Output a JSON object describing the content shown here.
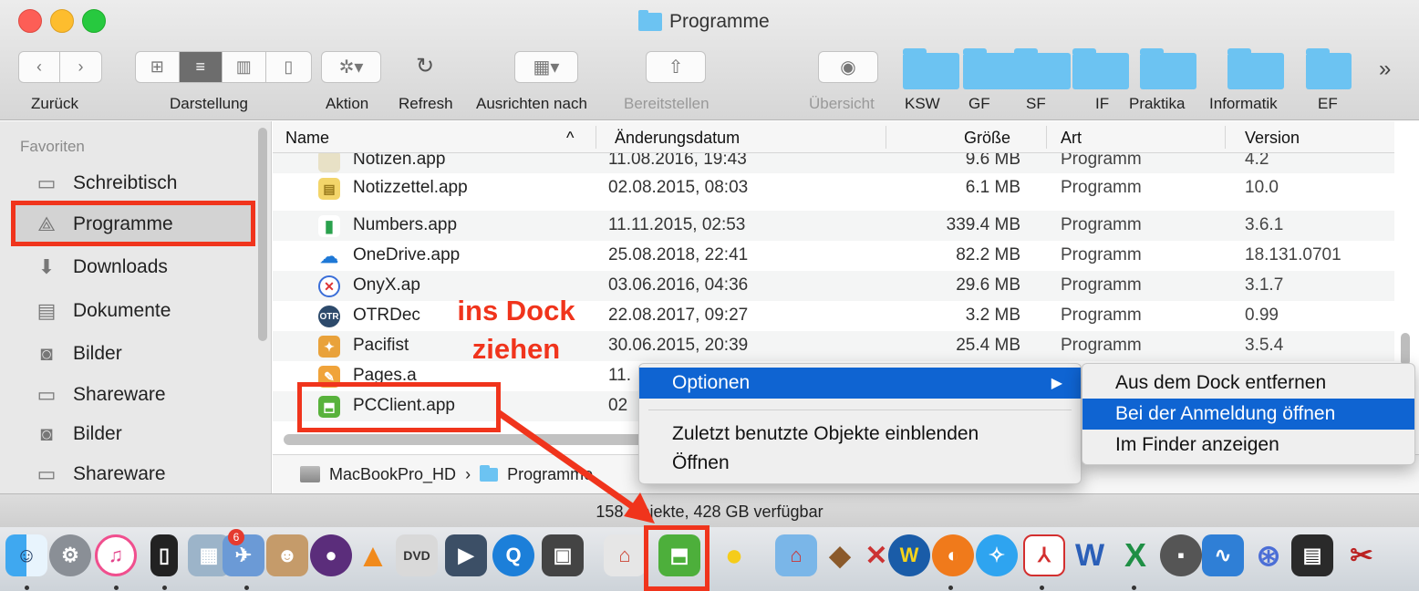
{
  "window": {
    "title": "Programme"
  },
  "toolbar": {
    "back_label": "Zurück",
    "view_label": "Darstellung",
    "action_label": "Aktion",
    "refresh_label": "Refresh",
    "arrange_label": "Ausrichten nach",
    "share_label": "Bereitstellen",
    "quicklook_label": "Übersicht",
    "overflow_glyph": "»",
    "favorites": [
      "KSW",
      "GF",
      "SF",
      "IF",
      "Praktika",
      "Informatik",
      "EF"
    ]
  },
  "sidebar": {
    "heading": "Favoriten",
    "items": [
      {
        "label": "Schreibtisch",
        "icon": "desktop-icon"
      },
      {
        "label": "Programme",
        "icon": "applications-icon"
      },
      {
        "label": "Downloads",
        "icon": "downloads-icon"
      },
      {
        "label": "Dokumente",
        "icon": "documents-icon"
      },
      {
        "label": "Bilder",
        "icon": "camera-icon"
      },
      {
        "label": "Shareware",
        "icon": "folder-icon"
      },
      {
        "label": "Bilder",
        "icon": "camera-icon"
      },
      {
        "label": "Shareware",
        "icon": "folder-icon"
      }
    ]
  },
  "columns": {
    "name": "Name",
    "sort_glyph": "^",
    "date": "Änderungsdatum",
    "size": "Größe",
    "kind": "Art",
    "version": "Version"
  },
  "files": [
    {
      "name": "Notizen.app",
      "date": "11.08.2016, 19:43",
      "size": "9.6 MB",
      "kind": "Programm",
      "version": "4.2"
    },
    {
      "name": "Notizzettel.app",
      "date": "02.08.2015, 08:03",
      "size": "6.1 MB",
      "kind": "Programm",
      "version": "10.0"
    },
    {
      "name": "Numbers.app",
      "date": "11.11.2015, 02:53",
      "size": "339.4 MB",
      "kind": "Programm",
      "version": "3.6.1"
    },
    {
      "name": "OneDrive.app",
      "date": "25.08.2018, 22:41",
      "size": "82.2 MB",
      "kind": "Programm",
      "version": "18.131.0701"
    },
    {
      "name": "OnyX.ap",
      "date": "03.06.2016, 04:36",
      "size": "29.6 MB",
      "kind": "Programm",
      "version": "3.1.7"
    },
    {
      "name": "OTRDec",
      "date": "22.08.2017, 09:27",
      "size": "3.2 MB",
      "kind": "Programm",
      "version": "0.99"
    },
    {
      "name": "Pacifist",
      "date": "30.06.2015, 20:39",
      "size": "25.4 MB",
      "kind": "Programm",
      "version": "3.5.4"
    },
    {
      "name": "Pages.a",
      "date": "11.",
      "size": "",
      "kind": "",
      "version": ""
    },
    {
      "name": "PCClient.app",
      "date": "02",
      "size": "",
      "kind": "",
      "version": ""
    }
  ],
  "pathbar": {
    "disk": "MacBookPro_HD",
    "sep": "›",
    "folder": "Programme"
  },
  "status": {
    "text": "158 Objekte, 428 GB verfügbar"
  },
  "context_menu": {
    "options": "Optionen",
    "arrow": "▶",
    "show_recent": "Zuletzt benutzte Objekte einblenden",
    "open": "Öffnen"
  },
  "submenu": {
    "remove": "Aus dem Dock entfernen",
    "open_at_login": "Bei der Anmeldung öffnen",
    "show_in_finder": "Im Finder anzeigen"
  },
  "annotation": {
    "line1": "ins Dock",
    "line2": "ziehen"
  },
  "dock": {
    "mail_badge": "6"
  },
  "colors": {
    "highlight": "#0f64d2",
    "annotation_red": "#f0341c",
    "folder_blue": "#6cc3f2"
  }
}
